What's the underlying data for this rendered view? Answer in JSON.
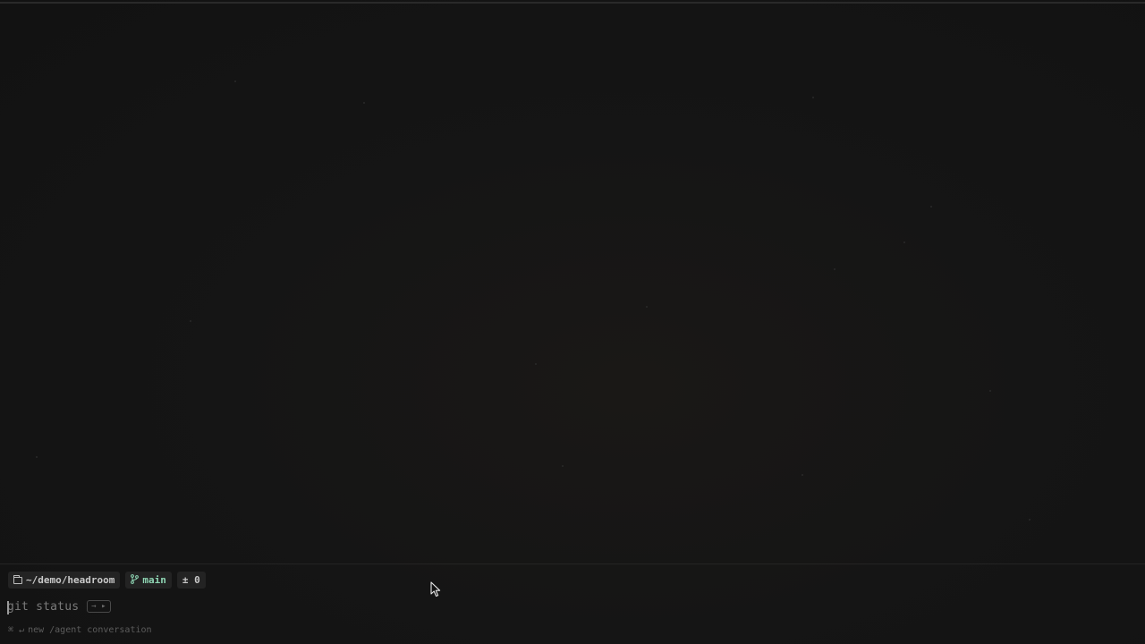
{
  "context_bar": {
    "directory": "~/demo/headroom",
    "branch": "main",
    "changes": "± 0",
    "directory_icon": "folder-icon",
    "branch_icon": "git-branch-icon"
  },
  "prompt": {
    "suggestion": "git status",
    "accept_key_label": "→ ▸"
  },
  "hint": {
    "keys": "⌘ ↵",
    "text": "new /agent conversation"
  },
  "colors": {
    "background": "#141414",
    "branch_accent": "#8fd6b4",
    "chip_background": "#232323"
  }
}
